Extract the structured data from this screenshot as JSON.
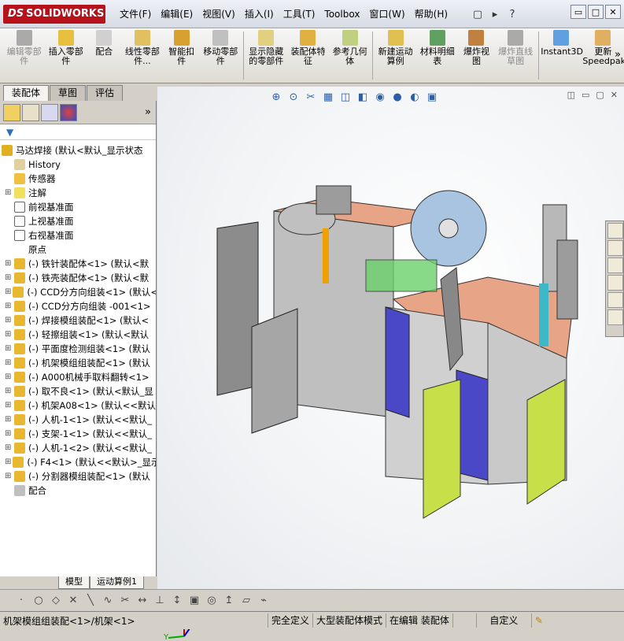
{
  "app": {
    "logo": "SOLIDWORKS"
  },
  "menu": [
    "文件(F)",
    "编辑(E)",
    "视图(V)",
    "插入(I)",
    "工具(T)",
    "Toolbox",
    "窗口(W)",
    "帮助(H)"
  ],
  "quick": [
    "new-doc-icon",
    "open-icon",
    "help-icon"
  ],
  "window_controls": [
    "▭",
    "□",
    "✕"
  ],
  "commands": [
    {
      "label": "编辑零部件",
      "disabled": true,
      "icon": "edit-component-icon"
    },
    {
      "label": "插入零部件",
      "icon": "insert-component-icon"
    },
    {
      "label": "配合",
      "icon": "mate-icon"
    },
    {
      "label": "线性零部件...",
      "icon": "linear-pattern-icon"
    },
    {
      "label": "智能扣件",
      "icon": "smart-fastener-icon"
    },
    {
      "label": "移动零部件",
      "icon": "move-component-icon"
    },
    {
      "label": "显示隐藏的零部件",
      "icon": "show-hidden-icon"
    },
    {
      "label": "装配体特征",
      "icon": "assembly-feature-icon"
    },
    {
      "label": "参考几何体",
      "icon": "reference-geometry-icon"
    },
    {
      "label": "新建运动算例",
      "icon": "motion-study-icon"
    },
    {
      "label": "材料明细表",
      "icon": "bom-icon"
    },
    {
      "label": "爆炸视图",
      "icon": "exploded-view-icon"
    },
    {
      "label": "爆炸直线草图",
      "disabled": true,
      "icon": "explode-line-icon"
    },
    {
      "label": "Instant3D",
      "icon": "instant3d-icon"
    },
    {
      "label": "更新Speedpak",
      "icon": "speedpak-icon"
    }
  ],
  "cmd_more": "»",
  "tabs": [
    "装配体",
    "草图",
    "评估"
  ],
  "fm_more": "»",
  "tree": {
    "root": "马达焊接 (默认<默认_显示状态",
    "items": [
      {
        "label": "History",
        "icon": "history-icon"
      },
      {
        "label": "传感器",
        "icon": "sensor-icon"
      },
      {
        "label": "注解",
        "icon": "annotation-icon",
        "expand": true
      },
      {
        "label": "前视基准面",
        "icon": "plane-icon"
      },
      {
        "label": "上视基准面",
        "icon": "plane-icon"
      },
      {
        "label": "右视基准面",
        "icon": "plane-icon"
      },
      {
        "label": "原点",
        "icon": "origin-icon"
      },
      {
        "label": "(-) 铁针装配体<1> (默认<默",
        "icon": "subassembly-icon",
        "expand": true
      },
      {
        "label": "(-) 铁壳装配体<1> (默认<默",
        "icon": "subassembly-icon",
        "expand": true
      },
      {
        "label": "(-) CCD分方向组装<1> (默认<",
        "icon": "subassembly-icon",
        "expand": true
      },
      {
        "label": "(-) CCD分方向组装 -001<1>",
        "icon": "subassembly-icon",
        "expand": true
      },
      {
        "label": "(-) 焊接模组装配<1> (默认<",
        "icon": "subassembly-icon",
        "expand": true
      },
      {
        "label": "(-) 轻擦组装<1> (默认<默认",
        "icon": "subassembly-icon",
        "expand": true
      },
      {
        "label": "(-) 平面度检测组装<1> (默认",
        "icon": "subassembly-icon",
        "expand": true
      },
      {
        "label": "(-) 机架模组组装配<1> (默认",
        "icon": "subassembly-icon",
        "expand": true
      },
      {
        "label": "(-) A000机械手取料翻转<1>",
        "icon": "subassembly-icon",
        "expand": true
      },
      {
        "label": "(-) 取不良<1> (默认<默认_显",
        "icon": "subassembly-icon",
        "expand": true
      },
      {
        "label": "(-) 机架A08<1> (默认<<默认",
        "icon": "subassembly-icon",
        "expand": true
      },
      {
        "label": "(-) 人机-1<1> (默认<<默认_",
        "icon": "subassembly-icon",
        "expand": true
      },
      {
        "label": "(-) 支架-1<1> (默认<<默认_",
        "icon": "subassembly-icon",
        "expand": true
      },
      {
        "label": "(-) 人机-1<2> (默认<<默认_",
        "icon": "subassembly-icon",
        "expand": true
      },
      {
        "label": "(-) F4<1> (默认<<默认>_显示",
        "icon": "subassembly-icon",
        "expand": true
      },
      {
        "label": "(-) 分割器模组装配<1> (默认",
        "icon": "subassembly-icon",
        "expand": true
      },
      {
        "label": "配合",
        "icon": "mates-icon"
      }
    ]
  },
  "bottom_tabs": [
    "模型",
    "运动算例1"
  ],
  "view_tools": [
    "zoom-fit-icon",
    "zoom-area-icon",
    "previous-view-icon",
    "section-view-icon",
    "view-orientation-icon",
    "display-style-icon",
    "hide-show-icon",
    "appearance-icon",
    "scene-icon",
    "view-settings-icon"
  ],
  "sketch_tools": [
    "point-icon",
    "circle-icon",
    "polygon-icon",
    "cross-icon",
    "line-icon",
    "spline-icon",
    "trim-icon",
    "dimension-icon",
    "relation-icon",
    "axis-icon",
    "box-icon",
    "sphere-icon",
    "arrow-icon",
    "plane-icon",
    "smart-icon"
  ],
  "status": {
    "path": "机架模组组装配<1>/机架<1>",
    "items": [
      "完全定义",
      "大型装配体模式",
      "在编辑 装配体",
      "",
      "自定义"
    ]
  },
  "triad": {
    "x": "X",
    "y": "Y",
    "z": "Z"
  },
  "colors": {
    "brand": "#b5121b",
    "viewport": "#f1f3f5",
    "panel": "#d4d0c8",
    "salmon": "#e8a486",
    "indigo": "#4b48c8",
    "lime": "#c7e04a"
  }
}
